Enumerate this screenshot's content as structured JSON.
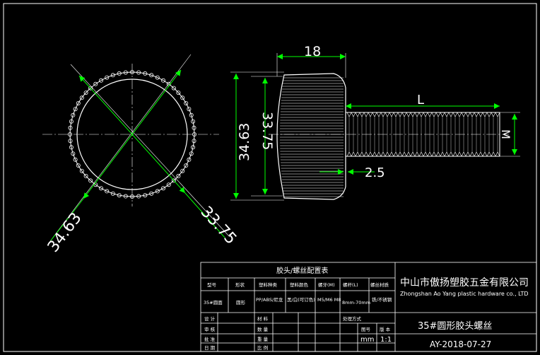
{
  "dimensions": {
    "head_width": "18",
    "outer_dia_front": "34.63",
    "inner_dia_front": "33.75",
    "outer_dia_side": "34.63",
    "inner_dia_side": "33.75",
    "thread_length": "L",
    "thread_dia": "M",
    "step": "2.5"
  },
  "title_block": {
    "table_title": "胶头/螺丝配置表",
    "headers": [
      "型号",
      "形状",
      "塑料种类",
      "塑料颜色",
      "螺牙(M)",
      "螺杆(L)",
      "螺丝材质"
    ],
    "row": [
      "35#圆面",
      "圆形",
      "PP/ABS/尼龙",
      "黑/白(可订色)",
      "M5/M6 M8",
      "8mm-70mm",
      "铁/不锈钢"
    ],
    "company_cn": "中山市傲扬塑胶五金有限公司",
    "company_en": "Zhongshan Ao Yang plastic hardware co., LTD",
    "part_name": "35#圆形胶头螺丝",
    "unit": "mm",
    "scale": "1:1",
    "date": "AY-2018-07-27",
    "lower_left_labels": [
      "设 计",
      "审 核",
      "批 准",
      "日 期"
    ],
    "lower_mid_labels": [
      "材 料",
      "数 量",
      "重 量",
      "比 例"
    ],
    "lower_mid2_labels": [
      "处理方式",
      "图号",
      "版 本"
    ]
  },
  "colors": {
    "background": "#000000",
    "lines": "#ffffff",
    "dimension": "#00ff00"
  }
}
